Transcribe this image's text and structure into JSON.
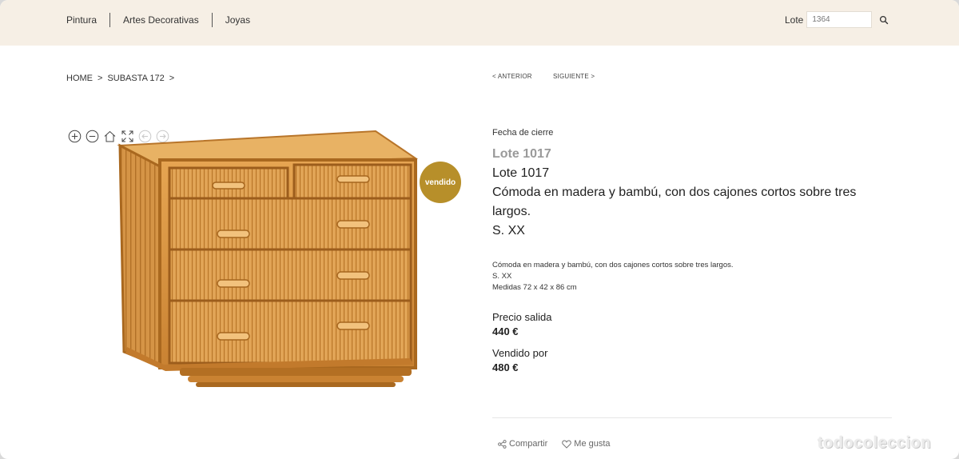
{
  "nav": {
    "items": [
      {
        "label": "Pintura"
      },
      {
        "label": "Artes Decorativas"
      },
      {
        "label": "Joyas"
      }
    ]
  },
  "search": {
    "label": "Lote",
    "value": "1364",
    "icon": "search-icon"
  },
  "breadcrumb": {
    "items": [
      {
        "label": "HOME"
      },
      {
        "label": "SUBASTA 172"
      }
    ],
    "separator": ">"
  },
  "pager": {
    "prev": "< ANTERIOR",
    "next": "SIGUIENTE >"
  },
  "image_tools": [
    "zoom-in-icon",
    "zoom-out-icon",
    "home-icon",
    "fullscreen-icon",
    "arrow-left-icon",
    "arrow-right-icon"
  ],
  "badge": {
    "label": "vendido",
    "color": "#b78f2a"
  },
  "lot": {
    "closing_label": "Fecha de cierre",
    "ghost_title": "Lote 1017",
    "title": "Lote 1017",
    "description_title": "Cómoda en madera y bambú, con dos cajones cortos sobre tres largos.",
    "century": "S. XX",
    "description_lines": [
      "Cómoda en madera y bambú, con dos cajones cortos sobre tres largos.",
      "S. XX",
      "Medidas 72 x 42 x 86 cm"
    ]
  },
  "prices": {
    "start_label": "Precio salida",
    "start_value": "440 €",
    "sold_label": "Vendido por",
    "sold_value": "480 €"
  },
  "actions": {
    "share": "Compartir",
    "like": "Me gusta"
  },
  "watermark": "todocoleccion",
  "colors": {
    "topbar_bg": "#f6efe5",
    "accent_gold": "#b78f2a"
  }
}
